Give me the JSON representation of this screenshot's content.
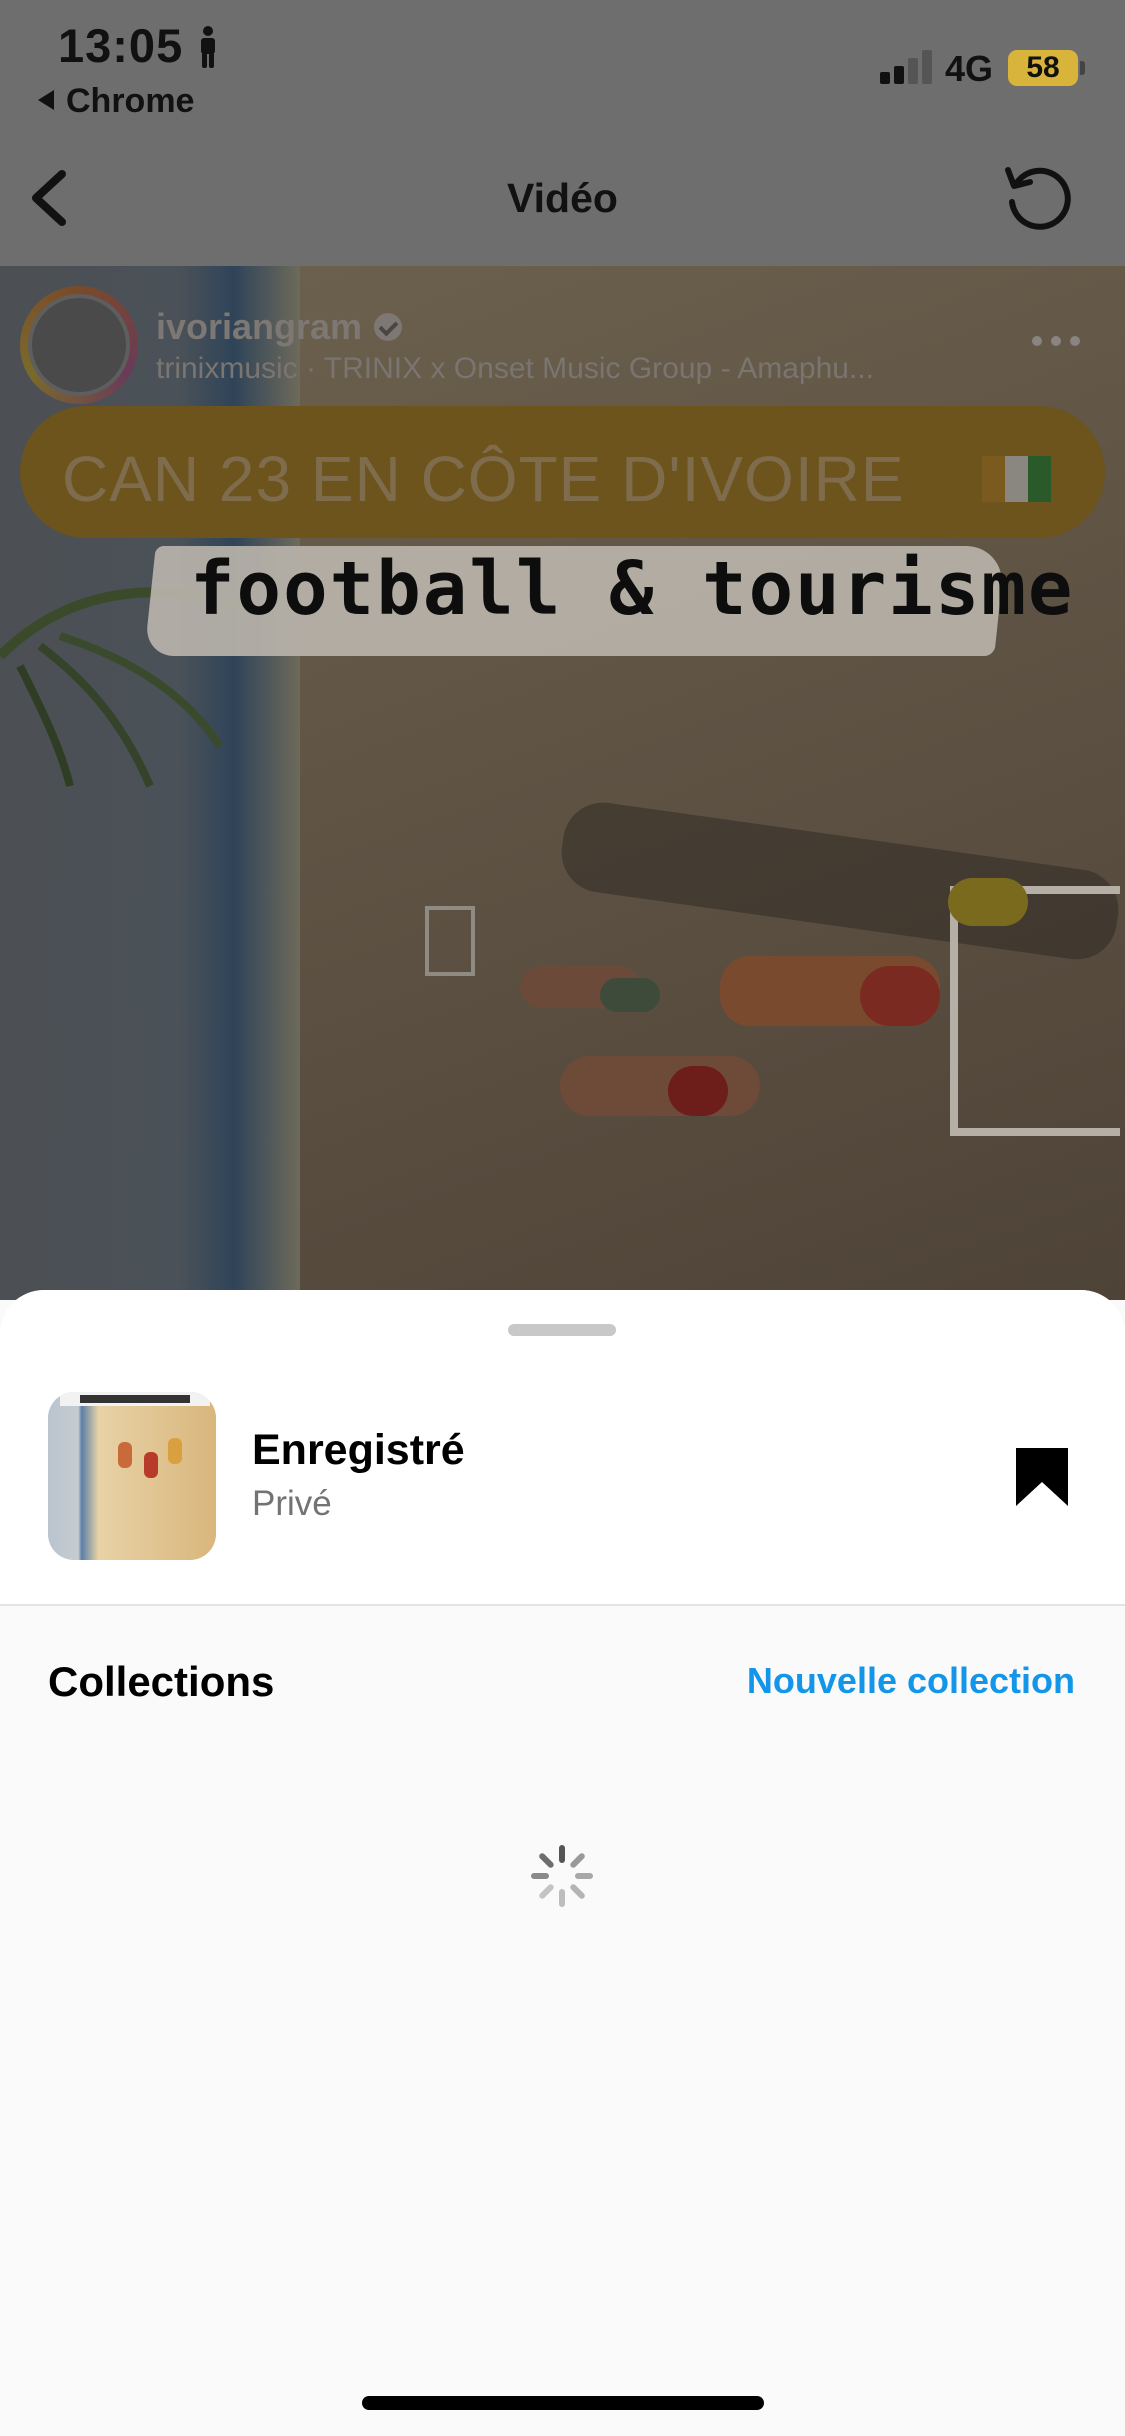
{
  "status_bar": {
    "time": "13:05",
    "back_app": "Chrome",
    "network": "4G",
    "battery": "58"
  },
  "nav": {
    "title": "Vidéo"
  },
  "post": {
    "username": "ivoriangram",
    "music": "trinixmusic · TRINIX x Onset Music Group - Amaphu...",
    "headline": "CAN 23 EN CÔTE D'IVOIRE",
    "subheadline": "football & tourisme"
  },
  "sheet": {
    "saved_title": "Enregistré",
    "saved_privacy": "Privé",
    "collections_title": "Collections",
    "new_collection": "Nouvelle collection"
  },
  "colors": {
    "accent_link": "#1396e9",
    "overlay_dim": "#6e6e6e"
  },
  "icons": [
    "person-icon",
    "signal-icon",
    "battery-icon",
    "back-icon",
    "refresh-icon",
    "verified-icon",
    "more-icon",
    "bookmark-icon",
    "spinner-icon"
  ]
}
